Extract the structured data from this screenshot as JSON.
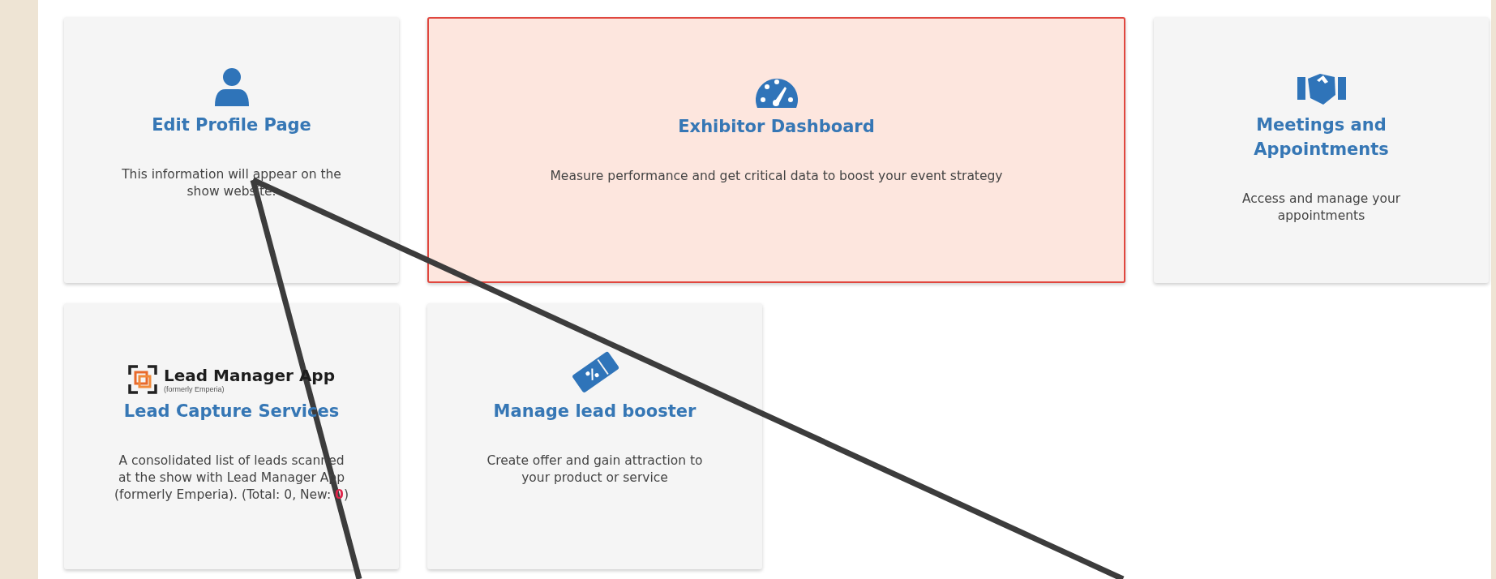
{
  "cards": [
    {
      "title": "Edit Profile Page",
      "description": "This information will appear on the show website.",
      "highlighted": false
    },
    {
      "title": "Exhibitor Dashboard",
      "description": "Measure performance and get critical data to boost your event strategy",
      "highlighted": true
    },
    {
      "title": "Meetings and Appointments",
      "description": "Access and manage your appointments",
      "highlighted": false
    },
    {
      "logo": {
        "name": "Lead Manager App",
        "subtitle": "(formerly Emperia)"
      },
      "title": "Lead Capture Services",
      "description": "A consolidated list of leads scanned at the show with Lead Manager App (formerly Emperia). (Total: 0, New: **0**)",
      "highlighted": false
    },
    {
      "title": "Manage lead booster",
      "description": "Create offer and gain attraction to your product or service",
      "highlighted": false
    }
  ]
}
